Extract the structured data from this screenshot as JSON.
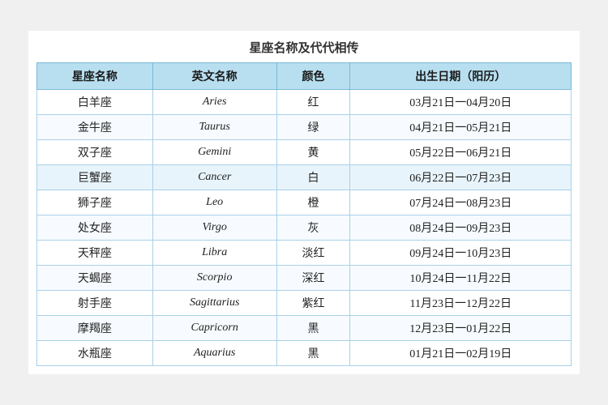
{
  "title": "星座名称及代代相传",
  "headers": [
    "星座名称",
    "英文名称",
    "颜色",
    "出生日期（阳历）"
  ],
  "rows": [
    {
      "chinese": "白羊座",
      "english": "Aries",
      "color": "红",
      "dates": "03月21日一04月20日",
      "highlight": false
    },
    {
      "chinese": "金牛座",
      "english": "Taurus",
      "color": "绿",
      "dates": "04月21日一05月21日",
      "highlight": false
    },
    {
      "chinese": "双子座",
      "english": "Gemini",
      "color": "黄",
      "dates": "05月22日一06月21日",
      "highlight": false
    },
    {
      "chinese": "巨蟹座",
      "english": "Cancer",
      "color": "白",
      "dates": "06月22日一07月23日",
      "highlight": true
    },
    {
      "chinese": "狮子座",
      "english": "Leo",
      "color": "橙",
      "dates": "07月24日一08月23日",
      "highlight": false
    },
    {
      "chinese": "处女座",
      "english": "Virgo",
      "color": "灰",
      "dates": "08月24日一09月23日",
      "highlight": false
    },
    {
      "chinese": "天秤座",
      "english": "Libra",
      "color": "淡红",
      "dates": "09月24日一10月23日",
      "highlight": false
    },
    {
      "chinese": "天蝎座",
      "english": "Scorpio",
      "color": "深红",
      "dates": "10月24日一11月22日",
      "highlight": false
    },
    {
      "chinese": "射手座",
      "english": "Sagittarius",
      "color": "紫红",
      "dates": "11月23日一12月22日",
      "highlight": false
    },
    {
      "chinese": "摩羯座",
      "english": "Capricorn",
      "color": "黑",
      "dates": "12月23日一01月22日",
      "highlight": false
    },
    {
      "chinese": "水瓶座",
      "english": "Aquarius",
      "color": "黑",
      "dates": "01月21日一02月19日",
      "highlight": false
    }
  ]
}
